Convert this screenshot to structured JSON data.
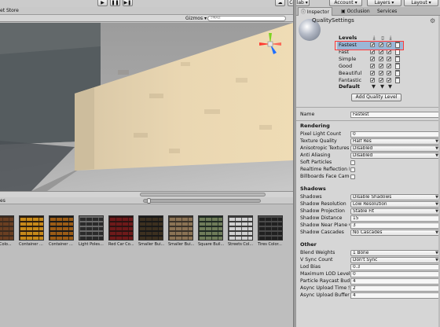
{
  "toolbar": {
    "play_icon": "play-icon",
    "pause_icon": "pause-icon",
    "step_icon": "step-icon",
    "collab_label": "Collab ▾",
    "account_label": "Account",
    "layers_label": "Layers",
    "layout_label": "Layout"
  },
  "left_tabs": {
    "asset_store": "et Store"
  },
  "scene_toolbar": {
    "gizmos": "Gizmos ▾",
    "search_placeholder": "▾All"
  },
  "project": {
    "header": "es",
    "assets": [
      {
        "label": "Tiles Colo...",
        "colors": [
          "#6a3f22",
          "#3b2a1e"
        ]
      },
      {
        "label": "Container ...",
        "colors": [
          "#c7891a",
          "#2b1d10"
        ]
      },
      {
        "label": "Container ...",
        "colors": [
          "#9b5c16",
          "#1a1a1a"
        ]
      },
      {
        "label": "Light Poles...",
        "colors": [
          "#2a2a2a",
          "#6b6b6b"
        ]
      },
      {
        "label": "Red Car Co...",
        "colors": [
          "#6e1a1a",
          "#2a1212"
        ]
      },
      {
        "label": "Smaller Bui...",
        "colors": [
          "#3c3020",
          "#181818"
        ]
      },
      {
        "label": "Smaller Bui...",
        "colors": [
          "#8b7355",
          "#3a3229"
        ]
      },
      {
        "label": "Square Buil...",
        "colors": [
          "#6f7c5a",
          "#1f2a23"
        ]
      },
      {
        "label": "Streets Col...",
        "colors": [
          "#d0d0d0",
          "#3b3b3b"
        ]
      },
      {
        "label": "Tires Color...",
        "colors": [
          "#202020",
          "#4b4b4b"
        ]
      }
    ]
  },
  "inspector": {
    "tabs": [
      {
        "label": "Inspector",
        "icon": "inspector-icon"
      },
      {
        "label": "Occlusion",
        "icon": "occlusion-icon"
      },
      {
        "label": "Services",
        "icon": ""
      }
    ],
    "object_title": "QualitySettings",
    "levels_title": "Levels",
    "platform_icons": [
      "download-icon",
      "phone-icon",
      "download-icon"
    ],
    "levels": [
      {
        "name": "Fastest",
        "selected": true
      },
      {
        "name": "Fast",
        "selected": false
      },
      {
        "name": "Simple",
        "selected": false
      },
      {
        "name": "Good",
        "selected": false
      },
      {
        "name": "Beautiful",
        "selected": false
      },
      {
        "name": "Fantastic",
        "selected": false
      }
    ],
    "default_label": "Default",
    "add_button": "Add Quality Level",
    "name_label": "Name",
    "name_value": "Fastest",
    "rendering": {
      "title": "Rendering",
      "pixel_light_count_label": "Pixel Light Count",
      "pixel_light_count": "0",
      "texture_quality_label": "Texture Quality",
      "texture_quality": "Half Res",
      "anisotropic_label": "Anisotropic Textures",
      "anisotropic": "Disabled",
      "anti_aliasing_label": "Anti Aliasing",
      "anti_aliasing": "Disabled",
      "soft_particles_label": "Soft Particles",
      "realtime_reflection_label": "Realtime Reflection Pr",
      "billboards_label": "Billboards Face Came"
    },
    "shadows": {
      "title": "Shadows",
      "shadows_label": "Shadows",
      "shadows_value": "Disable Shadows",
      "resolution_label": "Shadow Resolution",
      "resolution_value": "Low Resolution",
      "projection_label": "Shadow Projection",
      "projection_value": "Stable Fit",
      "distance_label": "Shadow Distance",
      "distance_value": "15",
      "near_plane_label": "Shadow Near Plane O",
      "near_plane_value": "3",
      "cascades_label": "Shadow Cascades",
      "cascades_value": "No Cascades"
    },
    "other": {
      "title": "Other",
      "blend_weights_label": "Blend Weights",
      "blend_weights_value": "1 Bone",
      "vsync_label": "V Sync Count",
      "vsync_value": "Don't Sync",
      "lod_bias_label": "Lod Bias",
      "lod_bias_value": "0.3",
      "max_lod_label": "Maximum LOD Level",
      "max_lod_value": "0",
      "raycast_label": "Particle Raycast Budg",
      "raycast_value": "4",
      "async_time_label": "Async Upload Time Sl",
      "async_time_value": "2",
      "async_buffer_label": "Async Upload Buffer S",
      "async_buffer_value": "4"
    }
  }
}
